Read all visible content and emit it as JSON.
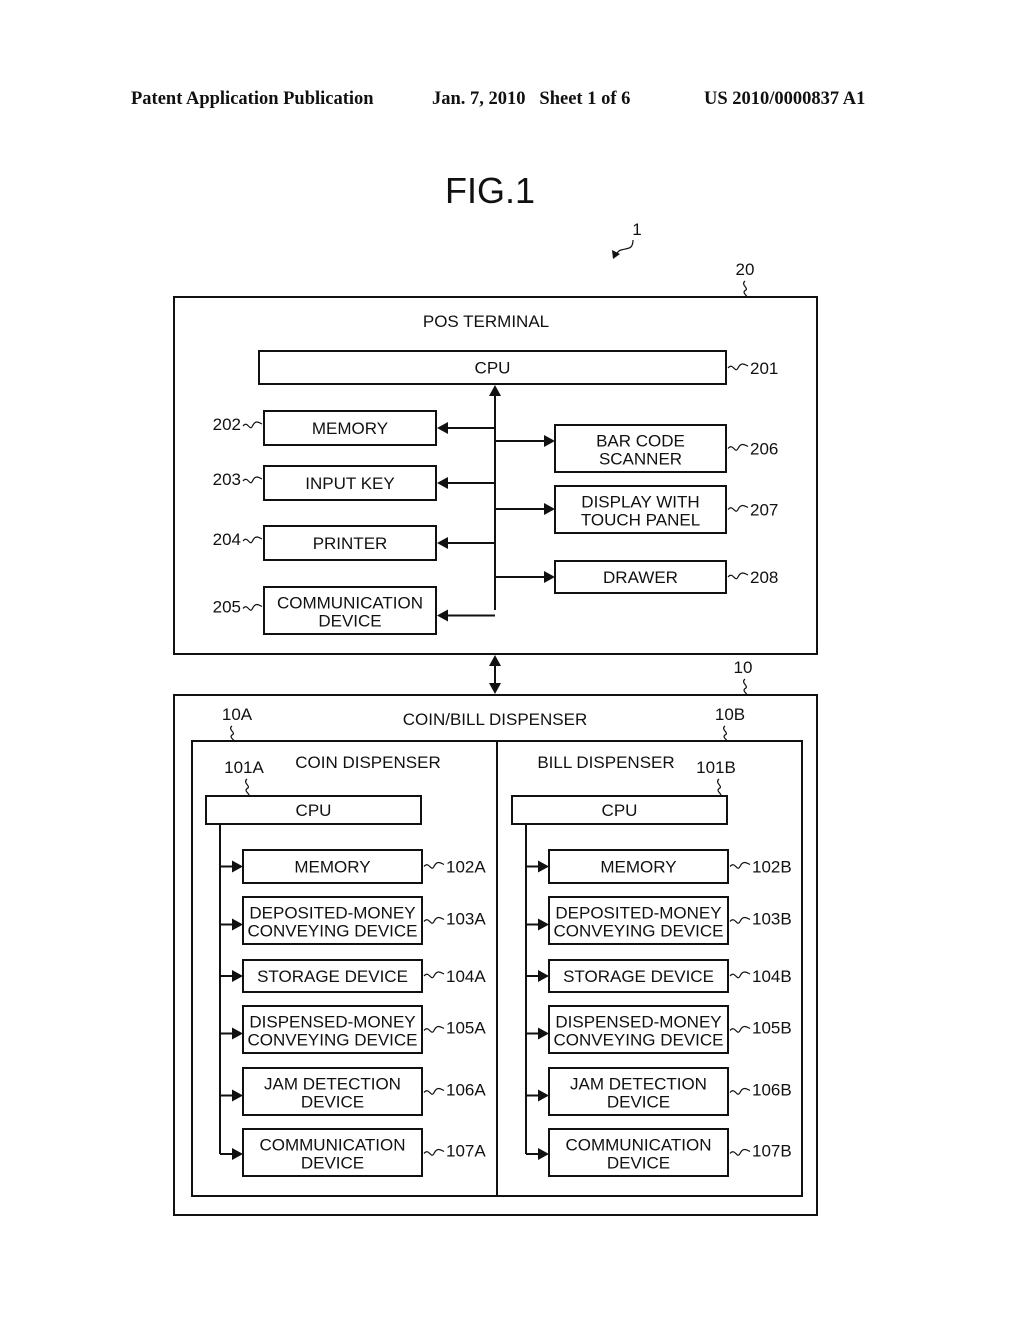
{
  "header": {
    "publication": "Patent Application Publication",
    "date_sheet": "Jan. 7, 2010   Sheet 1 of 6",
    "number": "US 2010/0000837 A1"
  },
  "figure": {
    "title": "FIG.1",
    "system_ref": "1"
  },
  "pos_terminal": {
    "ref": "20",
    "title": "POS TERMINAL",
    "cpu": {
      "label": [
        "CPU"
      ],
      "ref": "201"
    },
    "left_units": [
      {
        "label": [
          "MEMORY"
        ],
        "ref": "202"
      },
      {
        "label": [
          "INPUT KEY"
        ],
        "ref": "203"
      },
      {
        "label": [
          "PRINTER"
        ],
        "ref": "204"
      },
      {
        "label": [
          "COMMUNICATION",
          "DEVICE"
        ],
        "ref": "205"
      }
    ],
    "right_units": [
      {
        "label": [
          "BAR CODE",
          "SCANNER"
        ],
        "ref": "206"
      },
      {
        "label": [
          "DISPLAY WITH",
          "TOUCH PANEL"
        ],
        "ref": "207"
      },
      {
        "label": [
          "DRAWER"
        ],
        "ref": "208"
      }
    ]
  },
  "link": "bidirectional connection between POS terminal and coin/bill dispenser",
  "dispenser": {
    "ref": "10",
    "title": "COIN/BILL DISPENSER",
    "coin": {
      "ref": "10A",
      "title": "COIN DISPENSER",
      "cpu": {
        "label": [
          "CPU"
        ],
        "ref": "101A"
      },
      "units": [
        {
          "label": [
            "MEMORY"
          ],
          "ref": "102A"
        },
        {
          "label": [
            "DEPOSITED-MONEY",
            "CONVEYING DEVICE"
          ],
          "ref": "103A"
        },
        {
          "label": [
            "STORAGE DEVICE"
          ],
          "ref": "104A"
        },
        {
          "label": [
            "DISPENSED-MONEY",
            "CONVEYING DEVICE"
          ],
          "ref": "105A"
        },
        {
          "label": [
            "JAM DETECTION",
            "DEVICE"
          ],
          "ref": "106A"
        },
        {
          "label": [
            "COMMUNICATION",
            "DEVICE"
          ],
          "ref": "107A"
        }
      ]
    },
    "bill": {
      "ref": "10B",
      "title": "BILL DISPENSER",
      "cpu": {
        "label": [
          "CPU"
        ],
        "ref": "101B"
      },
      "units": [
        {
          "label": [
            "MEMORY"
          ],
          "ref": "102B"
        },
        {
          "label": [
            "DEPOSITED-MONEY",
            "CONVEYING DEVICE"
          ],
          "ref": "103B"
        },
        {
          "label": [
            "STORAGE DEVICE"
          ],
          "ref": "104B"
        },
        {
          "label": [
            "DISPENSED-MONEY",
            "CONVEYING DEVICE"
          ],
          "ref": "105B"
        },
        {
          "label": [
            "JAM DETECTION",
            "DEVICE"
          ],
          "ref": "106B"
        },
        {
          "label": [
            "COMMUNICATION",
            "DEVICE"
          ],
          "ref": "107B"
        }
      ]
    }
  }
}
